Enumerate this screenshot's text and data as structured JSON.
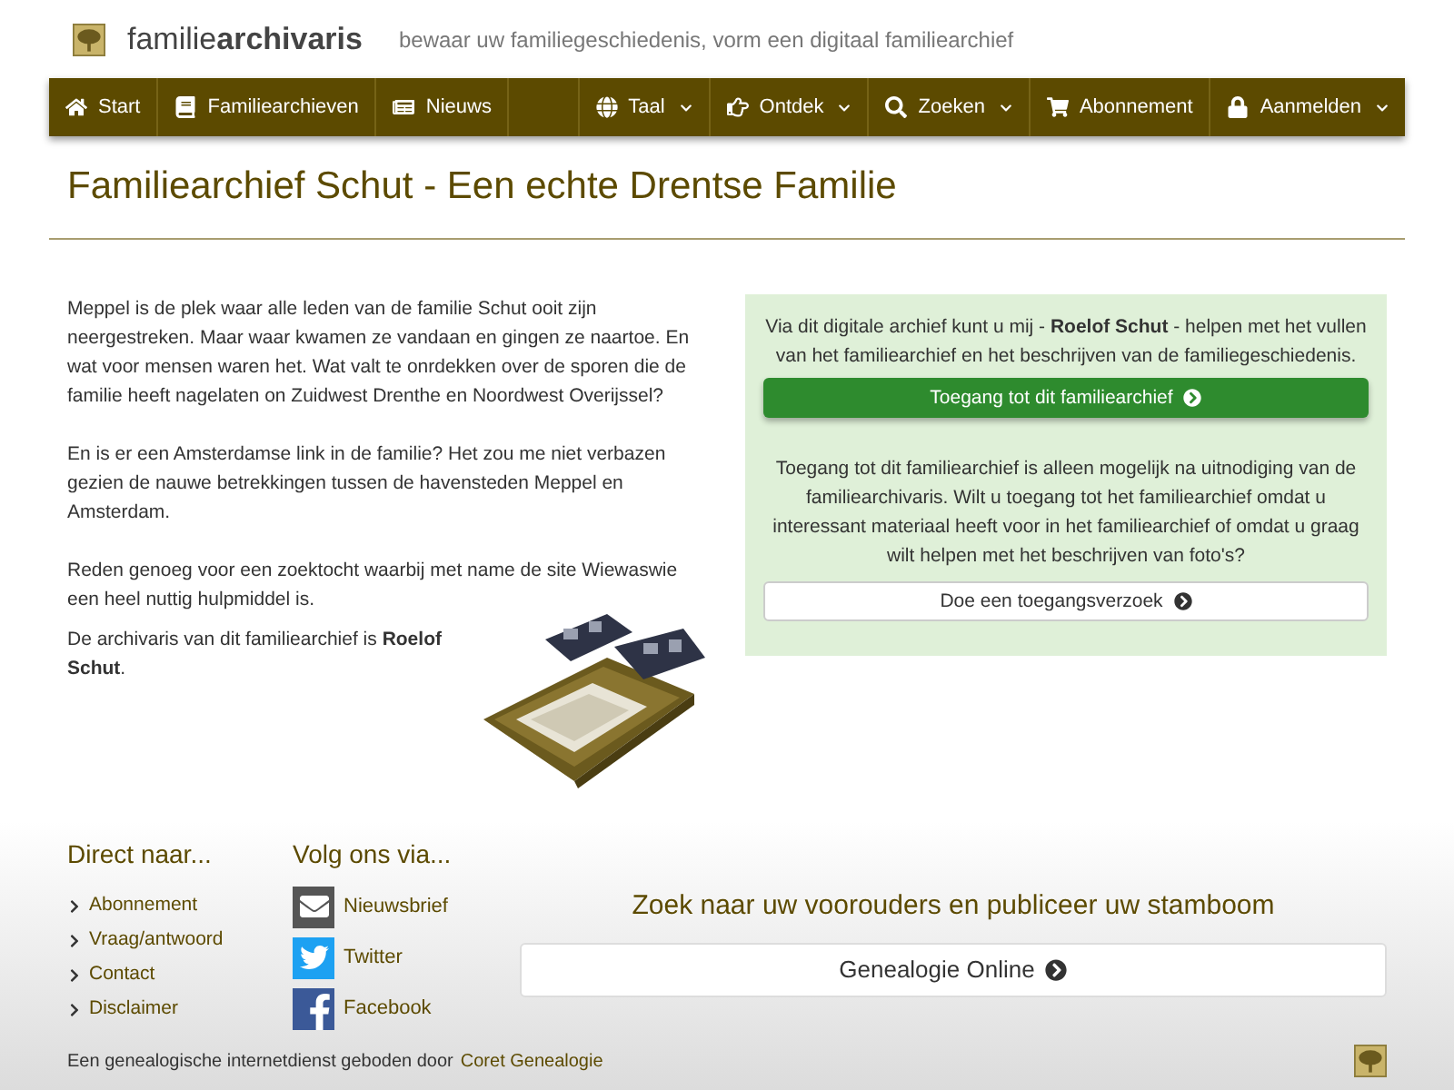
{
  "header": {
    "logo_text": "familie**archivaris**",
    "tagline": "bewaar uw familiegeschiedenis, vorm een digitaal familiearchief"
  },
  "nav": {
    "left": [
      {
        "label": "Start",
        "dropdown": false
      },
      {
        "label": "Familiearchieven",
        "dropdown": false
      },
      {
        "label": "Nieuws",
        "dropdown": false
      }
    ],
    "right": [
      {
        "label": "Taal",
        "dropdown": true
      },
      {
        "label": "Ontdek",
        "dropdown": true
      },
      {
        "label": "Zoeken",
        "dropdown": true
      },
      {
        "label": "Abonnement",
        "dropdown": false
      },
      {
        "label": "Aanmelden",
        "dropdown": true
      }
    ]
  },
  "page_title": "Familiearchief Schut - Een echte Drentse Familie",
  "intro": [
    "Meppel is de plek waar alle leden van de familie Schut ooit zijn neergestreken. Maar waar kwamen ze vandaan en gingen ze naartoe. En wat voor mensen waren het. Wat valt te onrdekken over de sporen die de familie heeft nagelaten on Zuidwest Drenthe en Noordwest Overijssel?",
    "En is er een Amsterdamse link in de familie? Het zou me niet verbazen gezien de nauwe betrekkingen tussen de havensteden Meppel en Amsterdam.",
    "Reden genoeg voor een zoektocht waarbij met name de site Wiewaswie een heel nuttig hulpmiddel is."
  ],
  "archivist_note": "De archivaris van dit familiearchief is **Roelof Schut**.",
  "panel": {
    "text": "Via dit digitale archief kunt u mij - **Roelof Schut** - helpen met het vullen van het familiearchief en het beschrijven van de familiegeschiedenis.",
    "primary_button": "Toegang tot dit familiearchief",
    "info": "Toegang tot dit familiearchief is alleen mogelijk na uitnodiging van de familiearchivaris. Wilt u toegang tot het familiearchief omdat u interessant materiaal heeft voor in het familiearchief of omdat u graag wilt helpen met het beschrijven van foto's?",
    "secondary_button": "Doe een toegangsverzoek"
  },
  "footer": {
    "direct_heading": "Direct naar...",
    "direct_links": [
      "Abonnement",
      "Vraag/antwoord",
      "Contact",
      "Disclaimer"
    ],
    "follow_heading": "Volg ons via...",
    "follow_links": [
      {
        "label": "Nieuwsbrief",
        "kind": "newsletter"
      },
      {
        "label": "Twitter",
        "kind": "twitter"
      },
      {
        "label": "Facebook",
        "kind": "facebook"
      }
    ],
    "promo_heading": "Zoek naar uw voorouders en publiceer uw stamboom",
    "promo_button": "Genealogie Online",
    "credit_text": "Een genealogische internetdienst geboden door",
    "credit_link": "Coret Genealogie"
  }
}
